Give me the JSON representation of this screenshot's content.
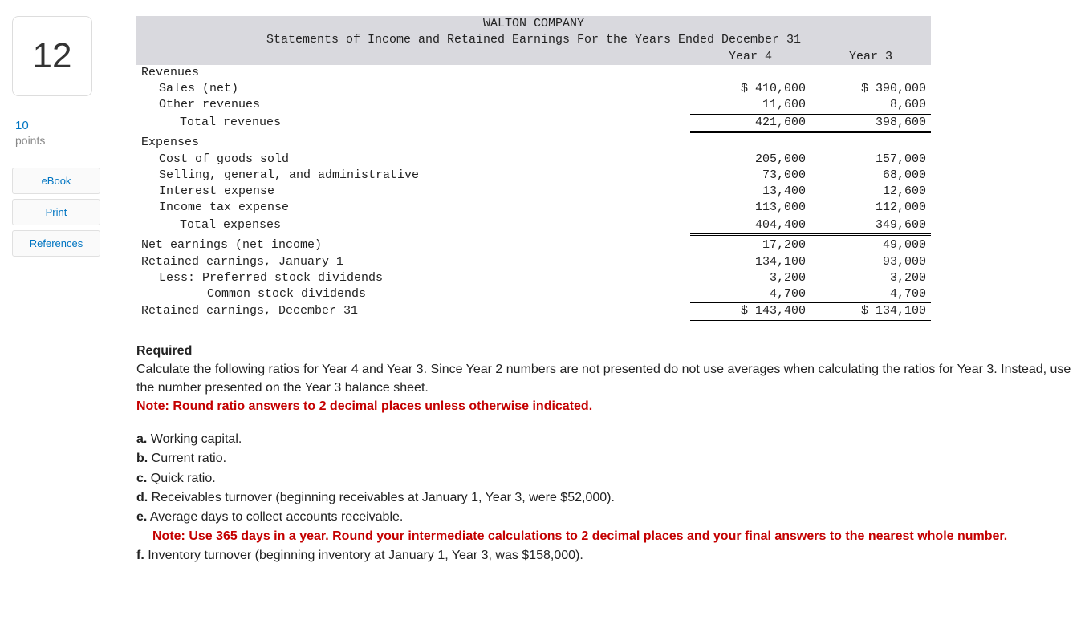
{
  "left": {
    "qnum": "12",
    "points_num": "10",
    "points_label": "points",
    "ebook": "eBook",
    "print": "Print",
    "references": "References"
  },
  "fin": {
    "company": "WALTON COMPANY",
    "title": "Statements of Income and Retained Earnings For the Years Ended December 31",
    "col_y4": "Year 4",
    "col_y3": "Year 3",
    "revenues_h": "Revenues",
    "sales_label": "Sales (net)",
    "sales_y4": "$ 410,000",
    "sales_y3": "$ 390,000",
    "other_rev_label": "Other revenues",
    "other_rev_y4": "11,600",
    "other_rev_y3": "8,600",
    "tot_rev_label": "Total revenues",
    "tot_rev_y4": "421,600",
    "tot_rev_y3": "398,600",
    "expenses_h": "Expenses",
    "cogs_label": "Cost of goods sold",
    "cogs_y4": "205,000",
    "cogs_y3": "157,000",
    "sga_label": "Selling, general, and administrative",
    "sga_y4": "73,000",
    "sga_y3": "68,000",
    "int_label": "Interest expense",
    "int_y4": "13,400",
    "int_y3": "12,600",
    "tax_label": "Income tax expense",
    "tax_y4": "113,000",
    "tax_y3": "112,000",
    "tot_exp_label": "Total expenses",
    "tot_exp_y4": "404,400",
    "tot_exp_y3": "349,600",
    "ne_label": "Net earnings (net income)",
    "ne_y4": "17,200",
    "ne_y3": "49,000",
    "re_jan_label": "Retained earnings, January 1",
    "re_jan_y4": "134,100",
    "re_jan_y3": "93,000",
    "pref_label": "Less: Preferred stock dividends",
    "pref_y4": "3,200",
    "pref_y3": "3,200",
    "comm_label": "Common stock dividends",
    "comm_y4": "4,700",
    "comm_y3": "4,700",
    "re_dec_label": "Retained earnings, December 31",
    "re_dec_y4": "$ 143,400",
    "re_dec_y3": "$ 134,100"
  },
  "req": {
    "heading": "Required",
    "intro": "Calculate the following ratios for Year 4 and Year 3. Since Year 2 numbers are not presented do not use averages when calculating the ratios for Year 3. Instead, use the number presented on the Year 3 balance sheet.",
    "note1": "Note: Round ratio answers to 2 decimal places unless otherwise indicated.",
    "a_b": "a.",
    "a": " Working capital.",
    "b_b": "b.",
    "b": " Current ratio.",
    "c_b": "c.",
    "c": " Quick ratio.",
    "d_b": "d.",
    "d": " Receivables turnover (beginning receivables at January 1, Year 3, were $52,000).",
    "e_b": "e.",
    "e": " Average days to collect accounts receivable.",
    "note2": "Note: Use 365 days in a year. Round your intermediate calculations to 2 decimal places and your final answers to the nearest whole number.",
    "f_b": "f.",
    "f": " Inventory turnover (beginning inventory at January 1, Year 3, was $158,000)."
  }
}
